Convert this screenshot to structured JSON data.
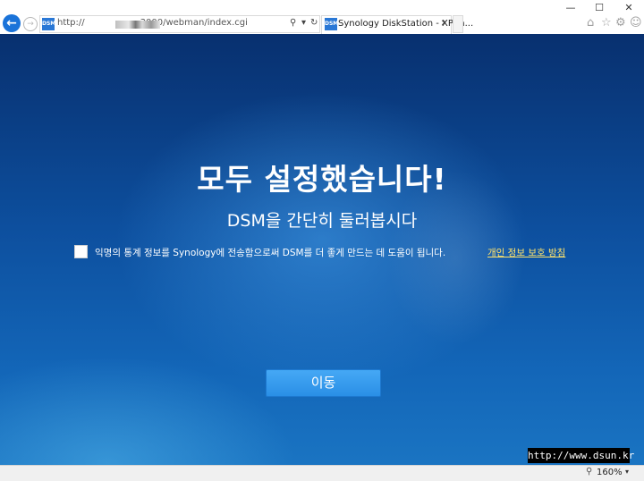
{
  "browser": {
    "address": "http://",
    "address_tail": "3000/webman/index.cgi",
    "search_icon": "search-icon",
    "dropdown_glyph": "▾",
    "refresh_glyph": "↻",
    "tab": {
      "favicon_text": "DSM",
      "title": "Synology DiskStation - XPEn...",
      "close_glyph": "✕"
    },
    "window_controls": {
      "minimize": "—",
      "maximize": "☐",
      "close": "✕"
    },
    "toolbar_icons": [
      "home-icon",
      "star-icon",
      "gear-icon",
      "smiley-icon"
    ]
  },
  "page": {
    "headline": "모두 설정했습니다!",
    "subtitle": "DSM을 간단히 둘러봅시다",
    "consent": {
      "checked": false,
      "text": "익명의 통계 정보를 Synology에 전송함으로써 DSM를 더 좋게 만드는 데 도움이 됩니다.",
      "link_text": "개인 정보 보호 방침"
    },
    "go_button": "이동",
    "watermark": "http://www.dsun.kr"
  },
  "statusbar": {
    "zoom": "160%",
    "zoom_dropdown_glyph": "▾"
  },
  "colors": {
    "background_dark": "#08306f",
    "background_light": "#1a74c2",
    "button": "#2a8fe6",
    "link": "#ffe36b"
  }
}
